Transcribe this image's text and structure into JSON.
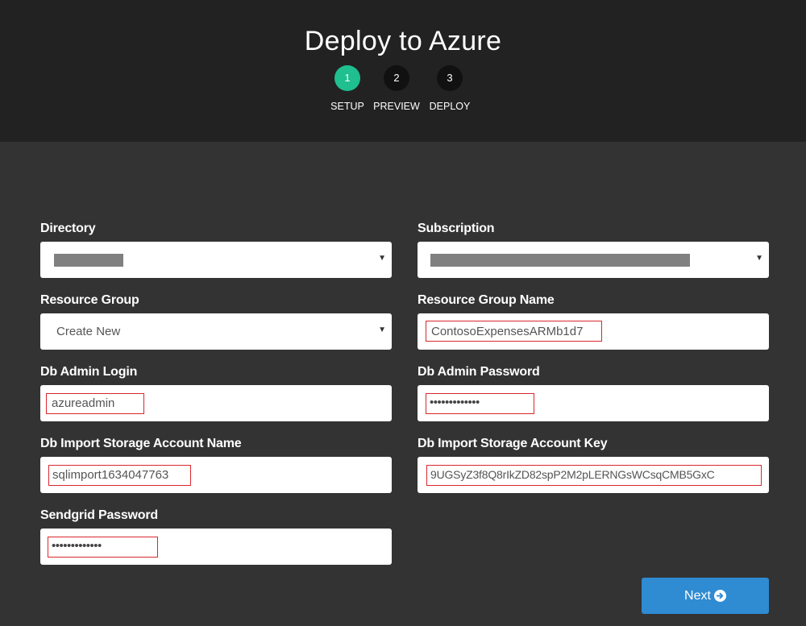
{
  "header": {
    "title": "Deploy to Azure",
    "steps": [
      {
        "number": "1",
        "label": "SETUP",
        "active": true
      },
      {
        "number": "2",
        "label": "PREVIEW",
        "active": false
      },
      {
        "number": "3",
        "label": "DEPLOY",
        "active": false
      }
    ]
  },
  "form": {
    "directory": {
      "label": "Directory",
      "value": ""
    },
    "subscription": {
      "label": "Subscription",
      "value": ""
    },
    "resource_group": {
      "label": "Resource Group",
      "value": "Create New"
    },
    "resource_group_name": {
      "label": "Resource Group Name",
      "value": "ContosoExpensesARMb1d7"
    },
    "db_admin_login": {
      "label": "Db Admin Login",
      "value": "azureadmin"
    },
    "db_admin_password": {
      "label": "Db Admin Password",
      "value": "•••••••••••••"
    },
    "db_import_storage_account_name": {
      "label": "Db Import Storage Account Name",
      "value": "sqlimport1634047763"
    },
    "db_import_storage_account_key": {
      "label": "Db Import Storage Account Key",
      "value": "9UGSyZ3f8Q8rIkZD82spP2M2pLERNGsWCsqCMB5GxC"
    },
    "sendgrid_password": {
      "label": "Sendgrid Password",
      "value": "•••••••••••••"
    }
  },
  "actions": {
    "next_label": "Next"
  },
  "icons": {
    "next": "arrow-circle-right-icon",
    "dropdown": "caret-down-icon"
  },
  "colors": {
    "header_bg": "#222222",
    "body_bg": "#333333",
    "active_step": "#1fbf8f",
    "next_button": "#2f8bd2",
    "highlight": "#d9272e"
  }
}
